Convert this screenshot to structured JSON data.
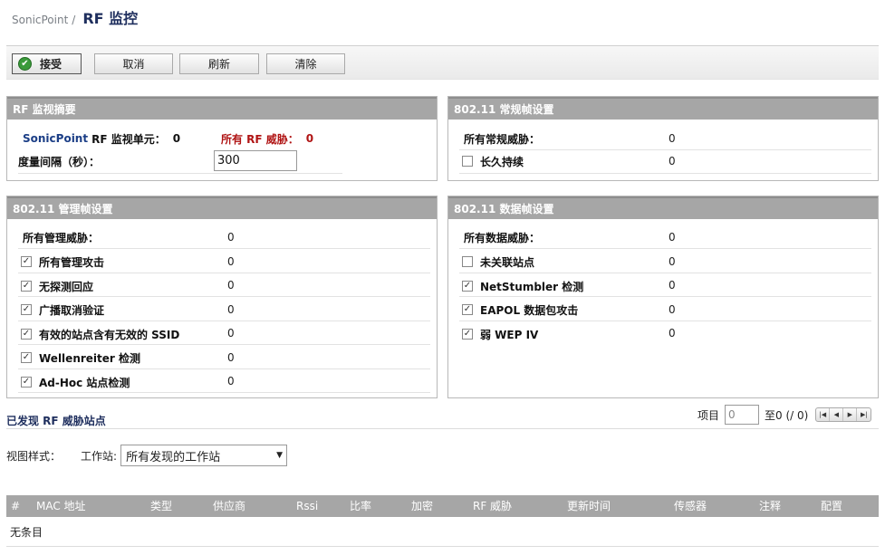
{
  "breadcrumb": {
    "parent": "SonicPoint",
    "separator": "/",
    "title": "RF 监控"
  },
  "toolbar": {
    "accept": "接受",
    "cancel": "取消",
    "refresh": "刷新",
    "clear": "清除"
  },
  "summary": {
    "header": "RF 监视摘要",
    "sp_name": "SonicPoint",
    "sp_rest": "RF 监视单元：",
    "sp_count": "0",
    "threats_label": "所有 RF 威胁：",
    "threats_count": "0",
    "interval_label": "度量间隔（秒）：",
    "interval_value": "300"
  },
  "general": {
    "header": "802.11 常规帧设置",
    "all_label": "所有常规威胁：",
    "all_value": "0",
    "items": [
      {
        "label": "长久持续",
        "value": "0",
        "checked": false
      }
    ]
  },
  "management": {
    "header": "802.11 管理帧设置",
    "all_label": "所有管理威胁：",
    "all_value": "0",
    "items": [
      {
        "label": "所有管理攻击",
        "value": "0",
        "checked": true
      },
      {
        "label": "无探测回应",
        "value": "0",
        "checked": true
      },
      {
        "label": "广播取消验证",
        "value": "0",
        "checked": true
      },
      {
        "label": "有效的站点含有无效的 SSID",
        "value": "0",
        "checked": true
      },
      {
        "label": "Wellenreiter 检测",
        "value": "0",
        "checked": true
      },
      {
        "label": "Ad-Hoc 站点检测",
        "value": "0",
        "checked": true
      }
    ]
  },
  "data_frames": {
    "header": "802.11 数据帧设置",
    "all_label": "所有数据威胁：",
    "all_value": "0",
    "items": [
      {
        "label": "未关联站点",
        "value": "0",
        "checked": false
      },
      {
        "label": "NetStumbler 检测",
        "value": "0",
        "checked": true
      },
      {
        "label": "EAPOL 数据包攻击",
        "value": "0",
        "checked": true
      },
      {
        "label": "弱 WEP IV",
        "value": "0",
        "checked": true
      }
    ]
  },
  "found": {
    "title": "已发现 RF 威胁站点",
    "items_label": "项目",
    "items_value": "0",
    "range_text": "至0 (/ 0)"
  },
  "view": {
    "label": "视图样式：",
    "station_label": "工作站:",
    "station_selected": "所有发现的工作站"
  },
  "table": {
    "columns": [
      "#",
      "MAC 地址",
      "类型",
      "供应商",
      "Rssi",
      "比率",
      "加密",
      "RF 威胁",
      "更新时间",
      "传感器",
      "注释",
      "配置"
    ],
    "empty": "无条目"
  },
  "colors": {
    "panel_header": "#a6a6a6",
    "title": "#1f2f5e",
    "threat_red": "#b01414",
    "accept_icon": "#3a9a3a"
  }
}
